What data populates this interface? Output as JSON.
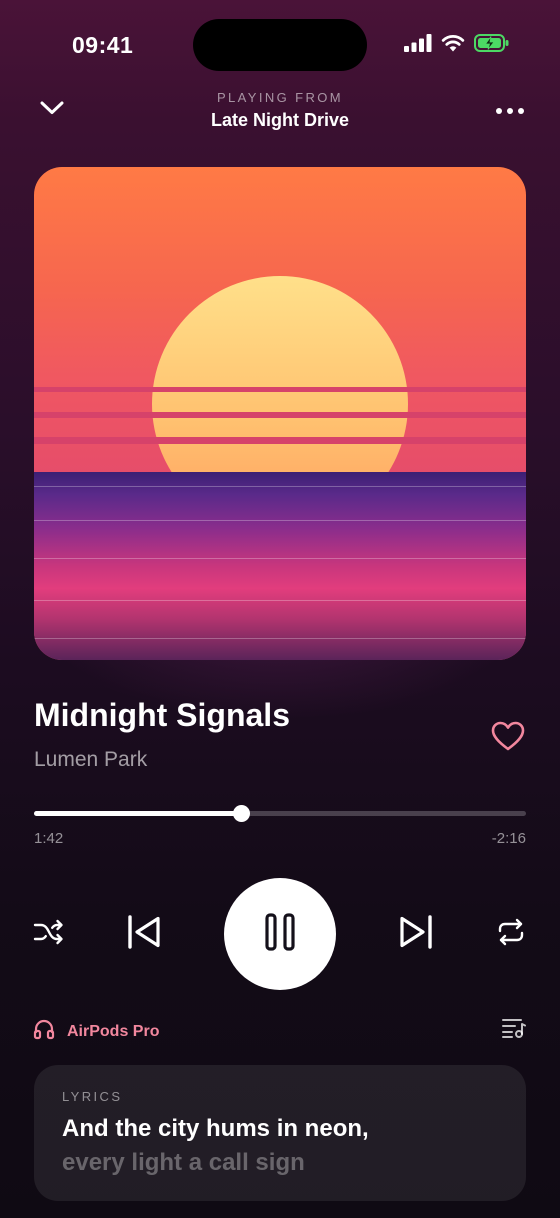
{
  "status_bar": {
    "time": "09:41",
    "signal_icon": "cellular-signal-icon",
    "wifi_icon": "wifi-icon",
    "battery_icon": "battery-charging-icon",
    "battery_color": "#4cd964"
  },
  "header": {
    "collapse_icon": "chevron-down-icon",
    "playing_from_label": "PLAYING FROM",
    "playlist_name": "Late Night Drive",
    "more_icon": "more-horizontal-icon"
  },
  "track": {
    "title": "Midnight Signals",
    "artist": "Lumen Park",
    "liked": false,
    "heart_icon": "heart-outline-icon",
    "heart_color": "#f2879e"
  },
  "progress": {
    "fraction": 0.42,
    "elapsed": "1:42",
    "remaining": "-2:16"
  },
  "controls": {
    "shuffle_icon": "shuffle-icon",
    "previous_icon": "skip-previous-icon",
    "play_state": "playing",
    "pause_icon": "pause-icon",
    "next_icon": "skip-next-icon",
    "repeat_icon": "repeat-icon"
  },
  "output": {
    "icon": "headphones-icon",
    "device_name": "AirPods Pro",
    "accent_color": "#f2879e",
    "queue_icon": "queue-music-icon"
  },
  "lyrics": {
    "label": "LYRICS",
    "current_line": "And the city hums in neon,",
    "next_line": "every light a call sign"
  }
}
